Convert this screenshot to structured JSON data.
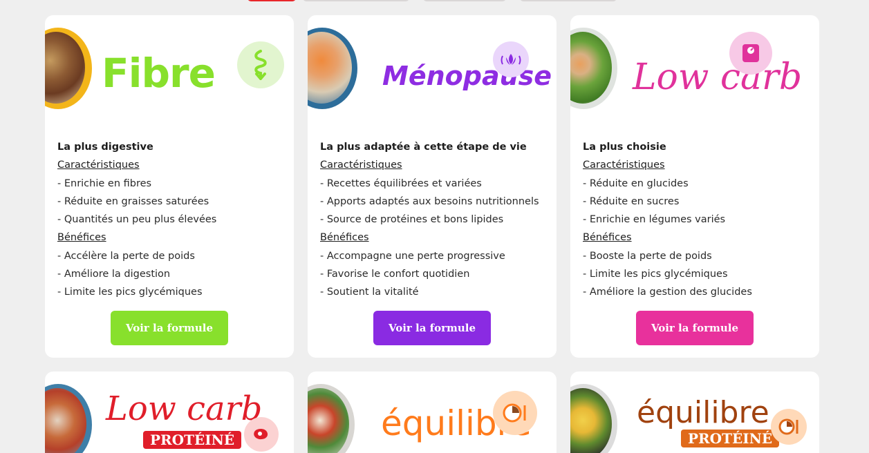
{
  "nav": {
    "tabs": [
      {
        "state": "active"
      },
      {
        "state": "inactive"
      },
      {
        "state": "inactive"
      },
      {
        "state": "inactive"
      }
    ]
  },
  "cards": [
    {
      "brand": "Fibre",
      "brand_color": "#88e02c",
      "accent": "#88e02c",
      "badge_icon": "intestine-icon",
      "tagline": "La plus digestive",
      "features_heading": "Caractéristiques",
      "features": [
        "- Enrichie en fibres",
        "- Réduite en graisses saturées",
        "- Quantités un peu plus élevées"
      ],
      "benefits_heading": "Bénéfices",
      "benefits": [
        "- Accélère la perte de poids",
        "- Améliore la digestion",
        "- Limite les pics glycémiques"
      ],
      "cta": "Voir la formule"
    },
    {
      "brand": "Ménopause",
      "brand_color": "#8e2de2",
      "accent": "#8a2be2",
      "badge_icon": "lotus-icon",
      "tagline": "La plus adaptée à cette étape de vie",
      "features_heading": "Caractéristiques",
      "features": [
        "- Recettes équilibrées et variées",
        "- Apports adaptés aux besoins nutritionnels",
        "- Source de protéines et bons lipides"
      ],
      "benefits_heading": "Bénéfices",
      "benefits": [
        "- Accompagne une perte progressive",
        "- Favorise le confort quotidien",
        "- Soutient la vitalité"
      ],
      "cta": "Voir la formule"
    },
    {
      "brand": "Low carb",
      "brand_color": "#e0329b",
      "accent": "#e8319c",
      "badge_icon": "scale-icon",
      "tagline": "La plus choisie",
      "features_heading": "Caractéristiques",
      "features": [
        "- Réduite en glucides",
        "- Réduite en sucres",
        "- Enrichie en légumes variés"
      ],
      "benefits_heading": "Bénéfices",
      "benefits": [
        "- Booste la perte de poids",
        "- Limite les pics glycémiques",
        "- Améliore la gestion des glucides"
      ],
      "cta": "Voir la formule"
    }
  ],
  "bottom_cards": [
    {
      "brand": "Low carb",
      "sticker": "PROTÉINÉ",
      "brand_color": "#e01e2a",
      "badge_icon": "steak-icon"
    },
    {
      "brand": "équilibre",
      "sticker": "",
      "brand_color": "#ff7b1c",
      "badge_icon": "plate-icon"
    },
    {
      "brand": "équilibre",
      "sticker": "PROTÉINÉ",
      "brand_color": "#a0420f",
      "badge_icon": "plate-icon"
    }
  ]
}
